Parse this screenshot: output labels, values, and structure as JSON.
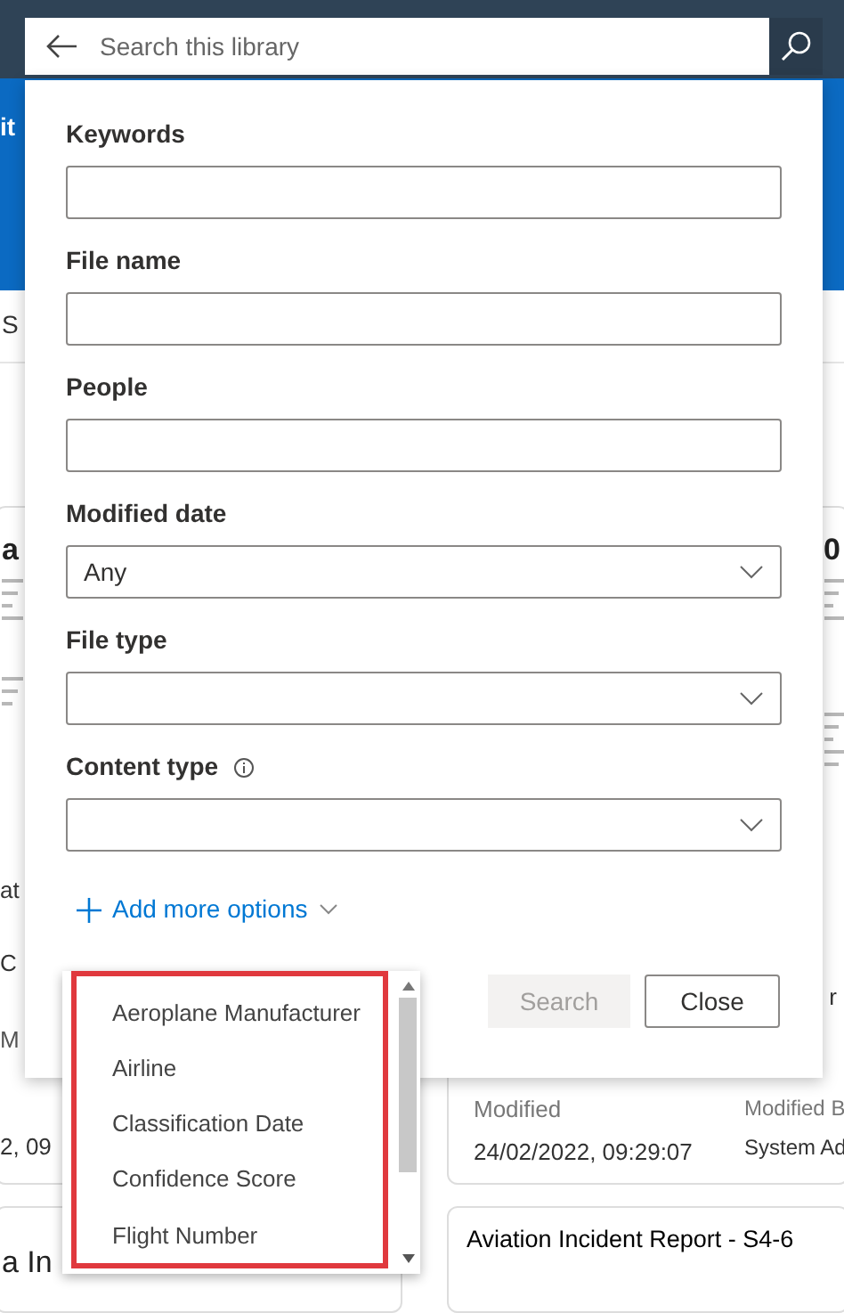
{
  "search": {
    "placeholder": "Search this library"
  },
  "fields": [
    {
      "label": "Keywords",
      "kind": "text"
    },
    {
      "label": "File name",
      "kind": "text"
    },
    {
      "label": "People",
      "kind": "text"
    },
    {
      "label": "Modified date",
      "kind": "select",
      "value": "Any"
    },
    {
      "label": "File type",
      "kind": "select"
    },
    {
      "label": "Content type",
      "kind": "select",
      "info": true
    }
  ],
  "add_more_options": "Add more options",
  "options_menu": [
    "Aeroplane Manufacturer",
    "Airline",
    "Classification Date",
    "Confidence Score",
    "Flight Number"
  ],
  "buttons": [
    {
      "label": "Search",
      "disabled": true
    },
    {
      "label": "Close",
      "disabled": false
    }
  ],
  "background": {
    "command_bar": "it",
    "view": "S",
    "left_fragments": [
      "a",
      "at",
      "C",
      "M",
      "2, 09",
      "a In"
    ],
    "right_fragments": [
      "0",
      "r"
    ],
    "right_card": {
      "modified_label": "Modified",
      "modified_value": "24/02/2022, 09:29:07",
      "modified_by_label": "Modified B",
      "modified_by_value": "System Ad"
    },
    "next_right_title": "Aviation Incident Report - S4-6"
  }
}
